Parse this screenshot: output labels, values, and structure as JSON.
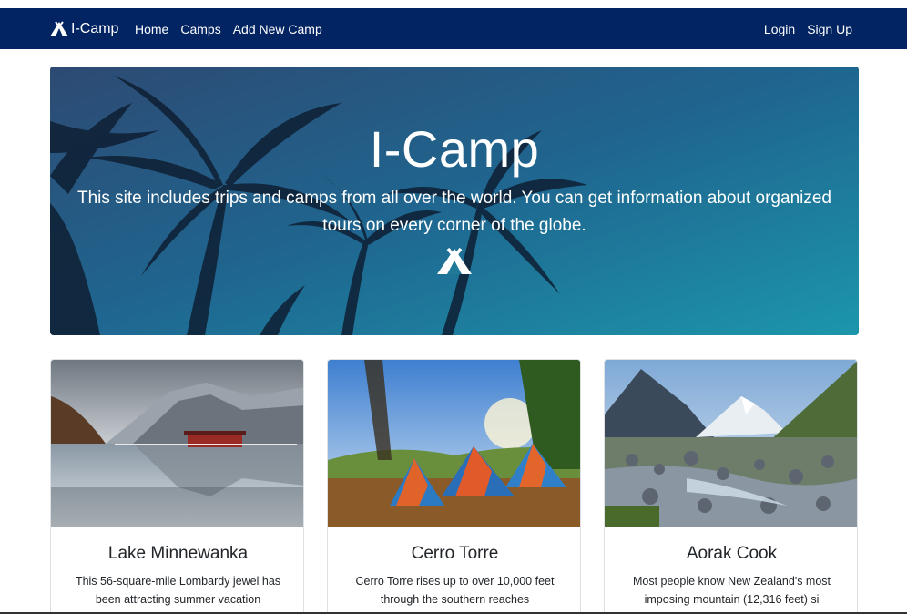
{
  "navbar": {
    "brand": "I-Camp",
    "links": [
      "Home",
      "Camps",
      "Add New Camp"
    ],
    "auth": [
      "Login",
      "Sign Up"
    ],
    "bg_color": "#032462"
  },
  "hero": {
    "title": "I-Camp",
    "text": "This site includes trips and camps from all over the world. You can get information about organized tours on every corner of the globe.",
    "icon": "tent-icon"
  },
  "cards": [
    {
      "title": "Lake Minnewanka",
      "text": "This 56-square-mile Lombardy jewel has been attracting summer vacation",
      "image": "lake-photo"
    },
    {
      "title": "Cerro Torre",
      "text": "Cerro Torre rises up to over 10,000 feet through the southern reaches",
      "image": "tents-photo"
    },
    {
      "title": "Aorak Cook",
      "text": "Most people know New Zealand's most imposing mountain (12,316 feet) si",
      "image": "mountain-river-photo"
    }
  ]
}
